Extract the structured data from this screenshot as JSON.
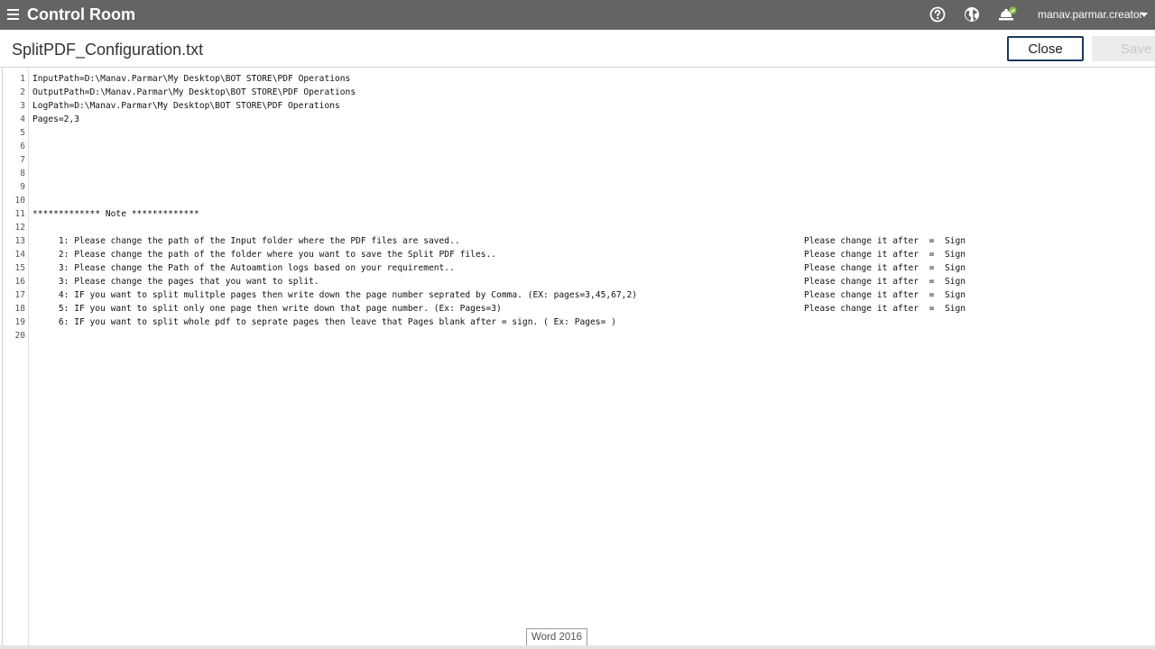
{
  "topbar": {
    "app_title": "Control Room",
    "user_name": "manav.parmar.creator",
    "icons": [
      "menu-icon",
      "help-icon",
      "globe-icon",
      "notifications-icon",
      "chevron-down-icon"
    ]
  },
  "header": {
    "file_name": "SplitPDF_Configuration.txt",
    "close_label": "Close",
    "save_label": "Save"
  },
  "editor": {
    "line_numbers": [
      "1",
      "2",
      "3",
      "4",
      "5",
      "6",
      "7",
      "8",
      "9",
      "10",
      "11",
      "12",
      "13",
      "14",
      "15",
      "16",
      "17",
      "18",
      "19",
      "20"
    ],
    "lines": [
      "InputPath=D:\\Manav.Parmar\\My Desktop\\BOT STORE\\PDF Operations",
      "OutputPath=D:\\Manav.Parmar\\My Desktop\\BOT STORE\\PDF Operations",
      "LogPath=D:\\Manav.Parmar\\My Desktop\\BOT STORE\\PDF Operations",
      "Pages=2,3",
      "",
      "",
      "",
      "",
      "",
      "",
      "************* Note *************",
      "",
      "     1: Please change the path of the Input folder where the PDF files are saved..",
      "     2: Please change the path of the folder where you want to save the Split PDF files..",
      "     3: Please change the Path of the Autoamtion logs based on your requirement..",
      "     3: Please change the pages that you want to split.",
      "     4: IF you want to split mulitple pages then write down the page number seprated by Comma. (EX: pages=3,45,67,2)",
      "     5: IF you want to split only one page then write down that page number. (Ex: Pages=3)",
      "     6: IF you want to split whole pdf to seprate pages then leave that Pages blank after = sign. ( Ex: Pages= )",
      ""
    ],
    "right_notes": [
      "Please change it after  =  Sign",
      "Please change it after  =  Sign",
      "Please change it after  =  Sign",
      "Please change it after  =  Sign",
      "Please change it after  =  Sign",
      "Please change it after  =  Sign"
    ]
  },
  "tooltip": {
    "text": "Word 2016"
  },
  "colors": {
    "topbar": "#646464",
    "close_border": "#1b3a5c",
    "save_disabled_bg": "#ececec"
  }
}
